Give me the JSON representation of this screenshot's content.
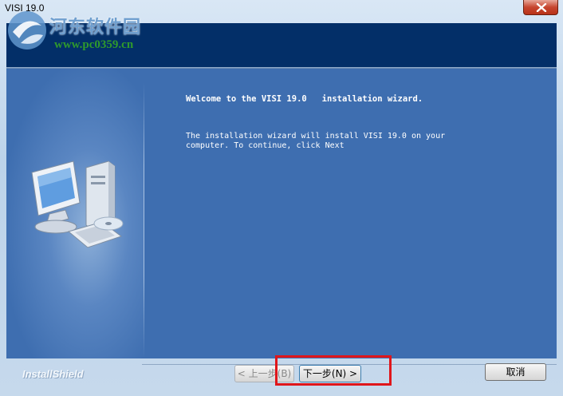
{
  "window": {
    "title": "VISI 19.0"
  },
  "watermark": {
    "site_name_cn": "河东软件园",
    "url": "www.pc0359.cn"
  },
  "content": {
    "welcome_title": "Welcome to the VISI 19.0   installation wizard.",
    "welcome_body": "The installation wizard will install VISI 19.0 on your\ncomputer. To continue, click Next"
  },
  "footer": {
    "brand": "InstallShield",
    "back_label": "< 上一步(B)",
    "next_label": "下一步(N) >",
    "cancel_label": "取消"
  },
  "colors": {
    "header_strip": "#032f68",
    "panel": "#3e6eb0",
    "highlight": "#e0161b"
  }
}
